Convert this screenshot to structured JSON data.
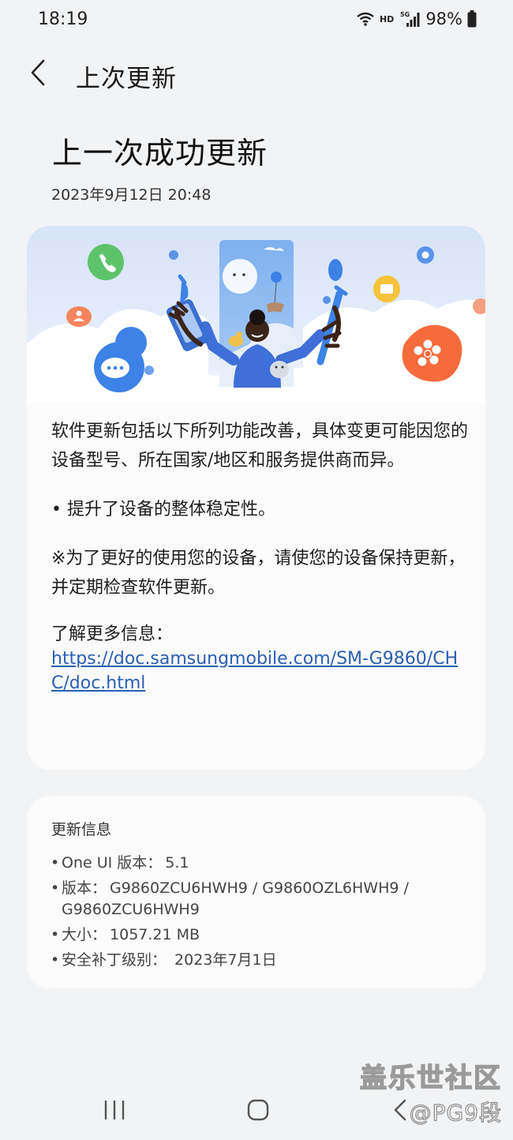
{
  "status_bar": {
    "time": "18:19",
    "network": "HD",
    "signal": "5G",
    "battery": "98%"
  },
  "header": {
    "title": "上次更新"
  },
  "page": {
    "title": "上一次成功更新",
    "date": "2023年9月12日 20:48"
  },
  "notes": {
    "intro": "软件更新包括以下所列功能改善，具体变更可能因您的设备型号、所在国家/地区和服务提供商而异。",
    "item": "• 提升了设备的整体稳定性。",
    "advice": "※为了更好的使用您的设备，请使您的设备保持更新，并定期检查软件更新。",
    "more_info_label": "了解更多信息：",
    "more_info_link": "https://doc.samsungmobile.com/SM-G9860/CHC/doc.html"
  },
  "update_info": {
    "title": "更新信息",
    "items": [
      {
        "label": "One UI 版本：",
        "value": "5.1"
      },
      {
        "label": "版本：",
        "value": "G9860ZCU6HWH9 / G9860OZL6HWH9 / G9860ZCU6HWH9"
      },
      {
        "label": "大小：",
        "value": "1057.21 MB"
      },
      {
        "label": "安全补丁级别：",
        "value": " 2023年7月1日"
      }
    ]
  },
  "watermark": {
    "line1": "盖乐世社区",
    "line2": "@PG9段"
  },
  "colors": {
    "background": "#f2f3f5",
    "card": "#fbfbfc",
    "link": "#2a5fb3",
    "accent_blue": "#3f6fd8"
  },
  "icons": {
    "back": "chevron-left-icon",
    "wifi": "wifi-icon",
    "signal": "signal-icon",
    "battery": "battery-icon",
    "recents": "recents-icon",
    "home": "home-icon",
    "nav_back": "nav-back-icon"
  }
}
